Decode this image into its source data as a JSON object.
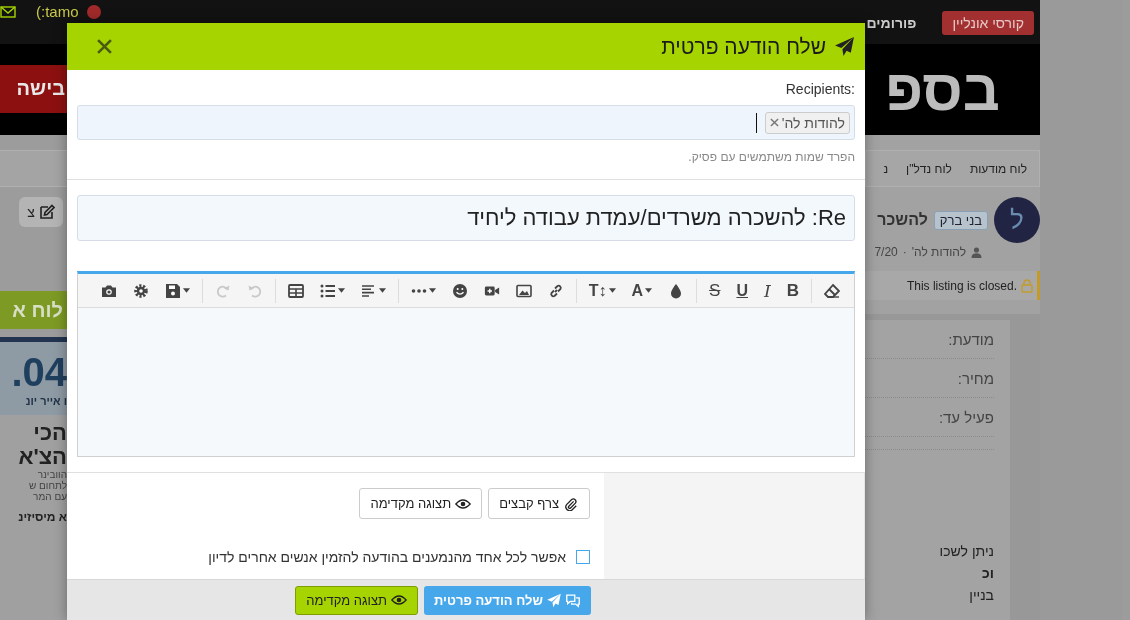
{
  "top_bar": {
    "user": "(:tamo",
    "nav": [
      {
        "label": "קורסי אונליין",
        "kind": "button"
      },
      {
        "label": "פורומים",
        "kind": "link"
      }
    ]
  },
  "left_strip": {
    "banner": "בישה",
    "edit": "צ",
    "board": "לוח א",
    "ad": {
      "big": ".04",
      "date": "ו אייר יונ",
      "headline": [
        "הכי",
        "הצ'א"
      ],
      "lines": [
        "הוובינר",
        "לתחום ש",
        "עם המר"
      ],
      "footer": "א מיסיזינ"
    }
  },
  "listing": {
    "logo": "בספ",
    "breadcrumbs": [
      "לוח מודעות",
      "לוח נדל\"ן",
      "נ"
    ],
    "avatar": "ל",
    "tag": "בני ברק",
    "title": "להשכר",
    "author": "להודות לה'",
    "separator": "·",
    "date": "7/20",
    "notice": "This listing is closed.",
    "fields": [
      "מודעת:",
      "מחיר:",
      "פעיל עד:"
    ],
    "body": [
      {
        "text": "ניתן לשכו",
        "bold": false
      },
      {
        "text": "וכ",
        "bold": true
      },
      {
        "text": "בניין",
        "bold": false
      }
    ]
  },
  "dialog": {
    "title": "שלח הודעה פרטית",
    "recipients_label": "Recipients:",
    "recipients": [
      "להודות לה'"
    ],
    "recipients_hint": "הפרד שמות משתמשים עם פסיק.",
    "subject": "Re: להשכרה משרדים/עמדת עבודה ליחיד",
    "toolbar": [
      [
        {
          "kind": "eraser",
          "disabled": false,
          "menu": false
        }
      ],
      [
        {
          "kind": "bold",
          "label": "B",
          "disabled": false,
          "menu": false
        },
        {
          "kind": "italic",
          "label": "I",
          "disabled": false,
          "menu": false
        },
        {
          "kind": "underline",
          "label": "U",
          "disabled": false,
          "menu": false
        },
        {
          "kind": "strike",
          "label": "S",
          "disabled": false,
          "menu": false
        }
      ],
      [
        {
          "kind": "droplet",
          "disabled": false,
          "menu": false
        },
        {
          "kind": "color",
          "label": "A",
          "disabled": false,
          "menu": true
        },
        {
          "kind": "size",
          "label": "T↕",
          "disabled": false,
          "menu": true
        }
      ],
      [
        {
          "kind": "link",
          "disabled": false,
          "menu": false
        },
        {
          "kind": "image",
          "disabled": false,
          "menu": false
        },
        {
          "kind": "video",
          "disabled": false,
          "menu": false
        },
        {
          "kind": "smiley",
          "disabled": false,
          "menu": false
        },
        {
          "kind": "more",
          "disabled": false,
          "menu": true
        }
      ],
      [
        {
          "kind": "align",
          "disabled": false,
          "menu": true
        },
        {
          "kind": "list",
          "disabled": false,
          "menu": true
        },
        {
          "kind": "table",
          "disabled": false,
          "menu": false
        }
      ],
      [
        {
          "kind": "undo",
          "disabled": true,
          "menu": false
        },
        {
          "kind": "redo",
          "disabled": true,
          "menu": false
        }
      ],
      [
        {
          "kind": "save",
          "disabled": false,
          "menu": true
        },
        {
          "kind": "gear",
          "disabled": false,
          "menu": false
        },
        {
          "kind": "camera",
          "disabled": false,
          "menu": false
        }
      ]
    ],
    "attach": "צרף קבצים",
    "preview": "תצוגה מקדימה",
    "allow_invite": {
      "label": "אפשר לכל אחד מהנמענים בהודעה להזמין אנשים אחרים לדיון",
      "checked": false
    },
    "send": "שלח הודעה פרטית",
    "footer_preview": "תצוגה מקדימה"
  }
}
